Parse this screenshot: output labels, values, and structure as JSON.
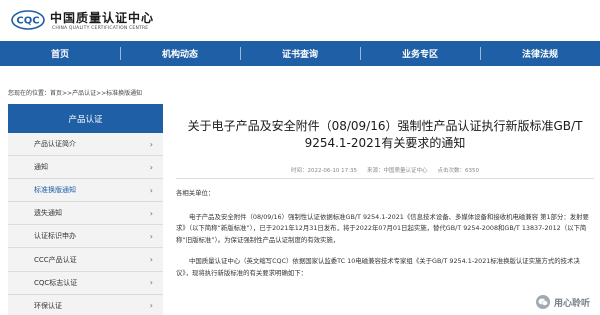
{
  "header": {
    "logo_text": "CQC",
    "site_name_cn": "中国质量认证中心",
    "site_name_en": "CHINA QUALITY CERTIFICATION CENTRE"
  },
  "nav": {
    "items": [
      "首页",
      "机构动态",
      "证书查询",
      "业务专区",
      "法律法规"
    ]
  },
  "breadcrumb": {
    "prefix": "您现在的位置：",
    "path": "首页>>产品认证>>标准换版通知"
  },
  "sidebar": {
    "title": "产品认证",
    "items": [
      {
        "label": "产品认证简介",
        "active": false
      },
      {
        "label": "通知",
        "active": false
      },
      {
        "label": "标准换版通知",
        "active": true
      },
      {
        "label": "遗失通知",
        "active": false
      },
      {
        "label": "认证标识申办",
        "active": false
      },
      {
        "label": "CCC产品认证",
        "active": false
      },
      {
        "label": "CQC标志认证",
        "active": false
      },
      {
        "label": "环保认证",
        "active": false
      }
    ]
  },
  "article": {
    "title": "关于电子产品及安全附件（08/09/16）强制性产品认证执行新版标准GB/T 9254.1-2021有关要求的通知",
    "time": "时间：2022-06-10 17:35",
    "source": "来源：中国质量认证中心",
    "views": "点击次数：6350",
    "greeting": "各相关单位：",
    "paragraphs": [
      "电子产品及安全附件（08/09/16）强制性认证依据标准GB/T 9254.1-2021《信息技术设备、多媒体设备和接收机电磁兼容 第1部分：发射要求》（以下简称“新版标准”），已于2021年12月31日发布，将于2022年07月01日起实施，替代GB/T 9254-2008和GB/T 13837-2012（以下简称“旧版标准”）。为保证强制性产品认证制度的有效实施，",
      "中国质量认证中心（英文缩写CQC）依据国家认监委TC 10电磁兼容技术专家组《关于GB/T 9254.1-2021标准换版认证实施方式的技术决议》，现将执行新版标准的有关要求明确如下："
    ]
  },
  "watermark": {
    "text": "用心聆听"
  },
  "colors": {
    "brand_blue": "#1f5fa6",
    "sidebar_bg": "#f3f3f3",
    "active_item": "#1f5fa6"
  }
}
